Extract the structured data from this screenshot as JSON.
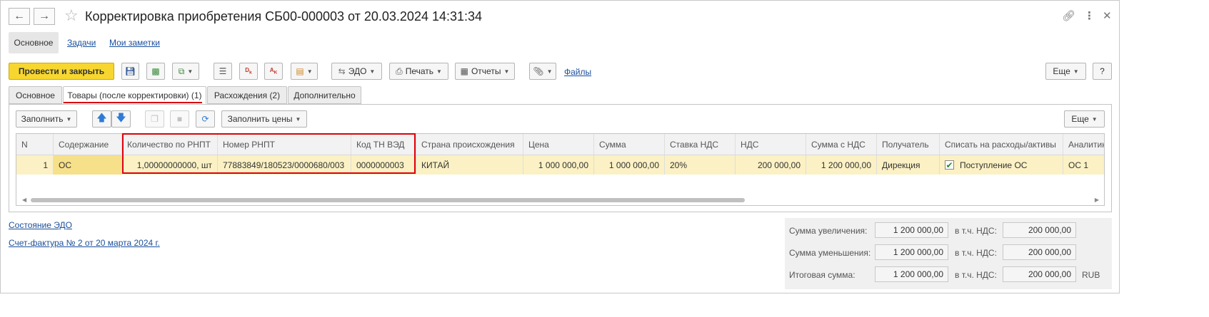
{
  "header": {
    "title": "Корректировка приобретения СБ00-000003 от 20.03.2024 14:31:34"
  },
  "section_nav": {
    "main": "Основное",
    "tasks": "Задачи",
    "notes": "Мои заметки"
  },
  "toolbar": {
    "post_close": "Провести и закрыть",
    "edo": "ЭДО",
    "print": "Печать",
    "reports": "Отчеты",
    "files": "Файлы",
    "more": "Еще",
    "help": "?"
  },
  "tabs": [
    {
      "label": "Основное"
    },
    {
      "label": "Товары (после корректировки) (1)"
    },
    {
      "label": "Расхождения (2)"
    },
    {
      "label": "Дополнительно"
    }
  ],
  "table_toolbar": {
    "fill": "Заполнить",
    "fill_prices": "Заполнить цены",
    "more": "Еще"
  },
  "table": {
    "columns": [
      "N",
      "Содержание",
      "Количество по РНПТ",
      "Номер РНПТ",
      "Код ТН ВЭД",
      "Страна происхождения",
      "Цена",
      "Сумма",
      "Ставка НДС",
      "НДС",
      "Сумма с НДС",
      "Получатель",
      "Списать на расходы/активы",
      "Аналитик"
    ],
    "rows": [
      {
        "n": "1",
        "content": "ОС",
        "qty": "1,00000000000, шт",
        "rnpt": "77883849/180523/0000680/003",
        "tnved": "0000000003",
        "country": "КИТАЙ",
        "price": "1 000 000,00",
        "sum": "1 000 000,00",
        "vat_rate": "20%",
        "vat": "200 000,00",
        "sum_vat": "1 200 000,00",
        "recipient": "Дирекция",
        "writeoff": "Поступление ОС",
        "analytics": "ОС 1"
      }
    ]
  },
  "footer_links": {
    "edo_state": "Состояние ЭДО",
    "invoice": "Счет-фактура № 2 от 20 марта 2024 г."
  },
  "totals": {
    "increase_label": "Сумма увеличения:",
    "increase": "1 200 000,00",
    "decrease_label": "Сумма уменьшения:",
    "decrease": "1 200 000,00",
    "total_label": "Итоговая сумма:",
    "total": "1 200 000,00",
    "vat_label": "в т.ч. НДС:",
    "vat_increase": "200 000,00",
    "vat_decrease": "200 000,00",
    "vat_total": "200 000,00",
    "currency": "RUB"
  },
  "colors": {
    "primary_button": "#f7d72f",
    "highlight_border": "#e0000b",
    "selected_row": "#fbf1c4",
    "link": "#1a4f9c"
  }
}
